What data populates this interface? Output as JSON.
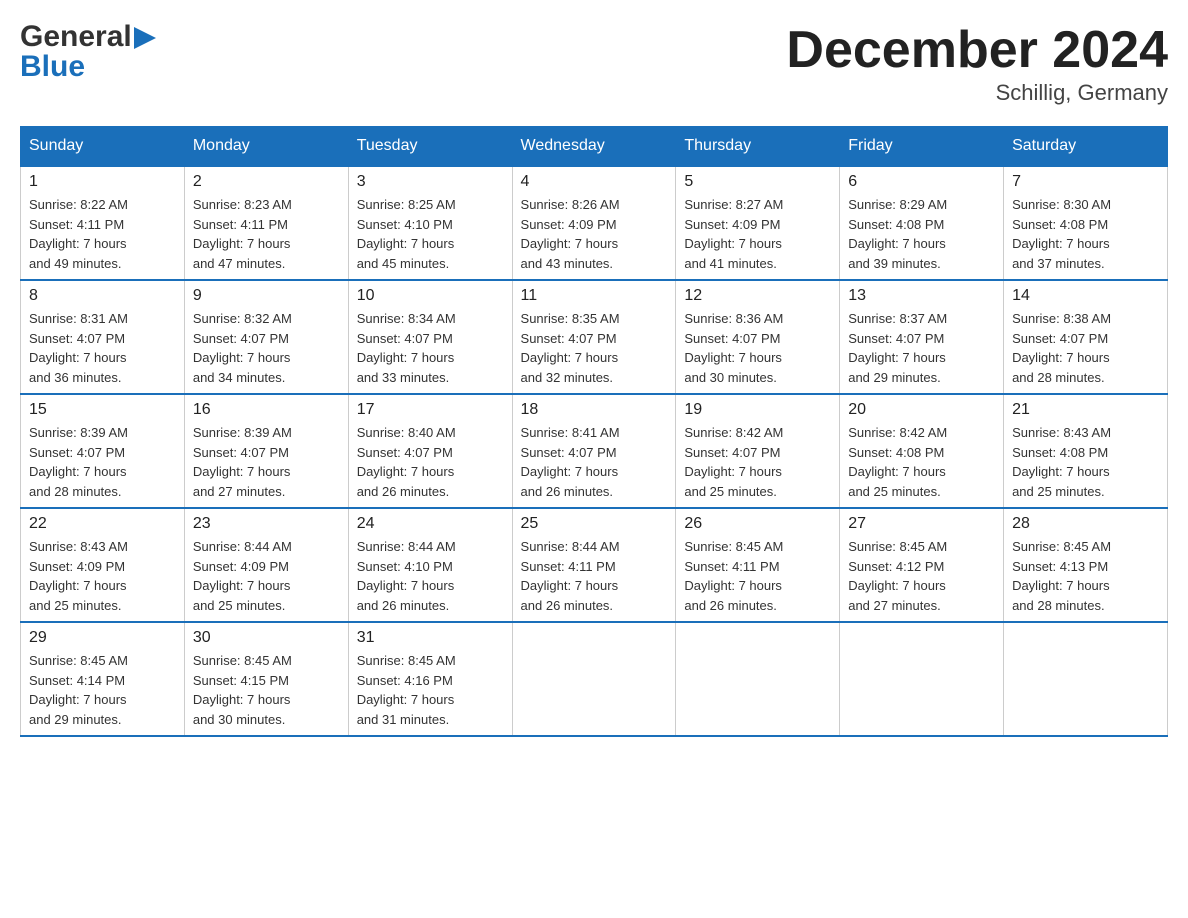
{
  "header": {
    "logo_general": "General",
    "logo_blue": "Blue",
    "month_year": "December 2024",
    "location": "Schillig, Germany"
  },
  "days_of_week": [
    "Sunday",
    "Monday",
    "Tuesday",
    "Wednesday",
    "Thursday",
    "Friday",
    "Saturday"
  ],
  "weeks": [
    [
      {
        "day": "1",
        "sunrise": "Sunrise: 8:22 AM",
        "sunset": "Sunset: 4:11 PM",
        "daylight": "Daylight: 7 hours",
        "daylight2": "and 49 minutes."
      },
      {
        "day": "2",
        "sunrise": "Sunrise: 8:23 AM",
        "sunset": "Sunset: 4:11 PM",
        "daylight": "Daylight: 7 hours",
        "daylight2": "and 47 minutes."
      },
      {
        "day": "3",
        "sunrise": "Sunrise: 8:25 AM",
        "sunset": "Sunset: 4:10 PM",
        "daylight": "Daylight: 7 hours",
        "daylight2": "and 45 minutes."
      },
      {
        "day": "4",
        "sunrise": "Sunrise: 8:26 AM",
        "sunset": "Sunset: 4:09 PM",
        "daylight": "Daylight: 7 hours",
        "daylight2": "and 43 minutes."
      },
      {
        "day": "5",
        "sunrise": "Sunrise: 8:27 AM",
        "sunset": "Sunset: 4:09 PM",
        "daylight": "Daylight: 7 hours",
        "daylight2": "and 41 minutes."
      },
      {
        "day": "6",
        "sunrise": "Sunrise: 8:29 AM",
        "sunset": "Sunset: 4:08 PM",
        "daylight": "Daylight: 7 hours",
        "daylight2": "and 39 minutes."
      },
      {
        "day": "7",
        "sunrise": "Sunrise: 8:30 AM",
        "sunset": "Sunset: 4:08 PM",
        "daylight": "Daylight: 7 hours",
        "daylight2": "and 37 minutes."
      }
    ],
    [
      {
        "day": "8",
        "sunrise": "Sunrise: 8:31 AM",
        "sunset": "Sunset: 4:07 PM",
        "daylight": "Daylight: 7 hours",
        "daylight2": "and 36 minutes."
      },
      {
        "day": "9",
        "sunrise": "Sunrise: 8:32 AM",
        "sunset": "Sunset: 4:07 PM",
        "daylight": "Daylight: 7 hours",
        "daylight2": "and 34 minutes."
      },
      {
        "day": "10",
        "sunrise": "Sunrise: 8:34 AM",
        "sunset": "Sunset: 4:07 PM",
        "daylight": "Daylight: 7 hours",
        "daylight2": "and 33 minutes."
      },
      {
        "day": "11",
        "sunrise": "Sunrise: 8:35 AM",
        "sunset": "Sunset: 4:07 PM",
        "daylight": "Daylight: 7 hours",
        "daylight2": "and 32 minutes."
      },
      {
        "day": "12",
        "sunrise": "Sunrise: 8:36 AM",
        "sunset": "Sunset: 4:07 PM",
        "daylight": "Daylight: 7 hours",
        "daylight2": "and 30 minutes."
      },
      {
        "day": "13",
        "sunrise": "Sunrise: 8:37 AM",
        "sunset": "Sunset: 4:07 PM",
        "daylight": "Daylight: 7 hours",
        "daylight2": "and 29 minutes."
      },
      {
        "day": "14",
        "sunrise": "Sunrise: 8:38 AM",
        "sunset": "Sunset: 4:07 PM",
        "daylight": "Daylight: 7 hours",
        "daylight2": "and 28 minutes."
      }
    ],
    [
      {
        "day": "15",
        "sunrise": "Sunrise: 8:39 AM",
        "sunset": "Sunset: 4:07 PM",
        "daylight": "Daylight: 7 hours",
        "daylight2": "and 28 minutes."
      },
      {
        "day": "16",
        "sunrise": "Sunrise: 8:39 AM",
        "sunset": "Sunset: 4:07 PM",
        "daylight": "Daylight: 7 hours",
        "daylight2": "and 27 minutes."
      },
      {
        "day": "17",
        "sunrise": "Sunrise: 8:40 AM",
        "sunset": "Sunset: 4:07 PM",
        "daylight": "Daylight: 7 hours",
        "daylight2": "and 26 minutes."
      },
      {
        "day": "18",
        "sunrise": "Sunrise: 8:41 AM",
        "sunset": "Sunset: 4:07 PM",
        "daylight": "Daylight: 7 hours",
        "daylight2": "and 26 minutes."
      },
      {
        "day": "19",
        "sunrise": "Sunrise: 8:42 AM",
        "sunset": "Sunset: 4:07 PM",
        "daylight": "Daylight: 7 hours",
        "daylight2": "and 25 minutes."
      },
      {
        "day": "20",
        "sunrise": "Sunrise: 8:42 AM",
        "sunset": "Sunset: 4:08 PM",
        "daylight": "Daylight: 7 hours",
        "daylight2": "and 25 minutes."
      },
      {
        "day": "21",
        "sunrise": "Sunrise: 8:43 AM",
        "sunset": "Sunset: 4:08 PM",
        "daylight": "Daylight: 7 hours",
        "daylight2": "and 25 minutes."
      }
    ],
    [
      {
        "day": "22",
        "sunrise": "Sunrise: 8:43 AM",
        "sunset": "Sunset: 4:09 PM",
        "daylight": "Daylight: 7 hours",
        "daylight2": "and 25 minutes."
      },
      {
        "day": "23",
        "sunrise": "Sunrise: 8:44 AM",
        "sunset": "Sunset: 4:09 PM",
        "daylight": "Daylight: 7 hours",
        "daylight2": "and 25 minutes."
      },
      {
        "day": "24",
        "sunrise": "Sunrise: 8:44 AM",
        "sunset": "Sunset: 4:10 PM",
        "daylight": "Daylight: 7 hours",
        "daylight2": "and 26 minutes."
      },
      {
        "day": "25",
        "sunrise": "Sunrise: 8:44 AM",
        "sunset": "Sunset: 4:11 PM",
        "daylight": "Daylight: 7 hours",
        "daylight2": "and 26 minutes."
      },
      {
        "day": "26",
        "sunrise": "Sunrise: 8:45 AM",
        "sunset": "Sunset: 4:11 PM",
        "daylight": "Daylight: 7 hours",
        "daylight2": "and 26 minutes."
      },
      {
        "day": "27",
        "sunrise": "Sunrise: 8:45 AM",
        "sunset": "Sunset: 4:12 PM",
        "daylight": "Daylight: 7 hours",
        "daylight2": "and 27 minutes."
      },
      {
        "day": "28",
        "sunrise": "Sunrise: 8:45 AM",
        "sunset": "Sunset: 4:13 PM",
        "daylight": "Daylight: 7 hours",
        "daylight2": "and 28 minutes."
      }
    ],
    [
      {
        "day": "29",
        "sunrise": "Sunrise: 8:45 AM",
        "sunset": "Sunset: 4:14 PM",
        "daylight": "Daylight: 7 hours",
        "daylight2": "and 29 minutes."
      },
      {
        "day": "30",
        "sunrise": "Sunrise: 8:45 AM",
        "sunset": "Sunset: 4:15 PM",
        "daylight": "Daylight: 7 hours",
        "daylight2": "and 30 minutes."
      },
      {
        "day": "31",
        "sunrise": "Sunrise: 8:45 AM",
        "sunset": "Sunset: 4:16 PM",
        "daylight": "Daylight: 7 hours",
        "daylight2": "and 31 minutes."
      },
      null,
      null,
      null,
      null
    ]
  ]
}
